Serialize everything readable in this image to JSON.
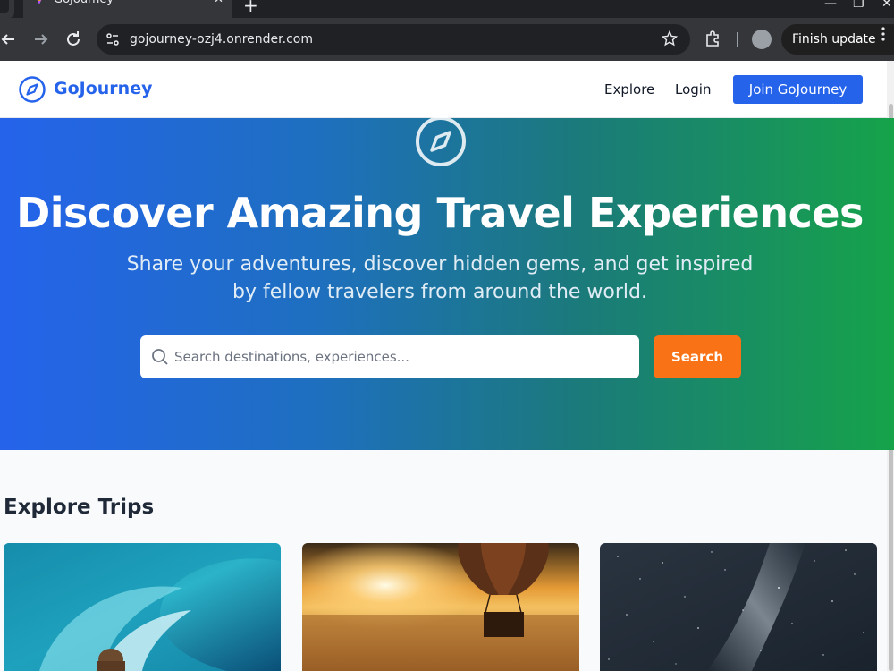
{
  "browser": {
    "tab_title": "GoJourney",
    "url": "gojourney-ozj4.onrender.com",
    "finish_update_label": "Finish update"
  },
  "header": {
    "brand": "GoJourney",
    "nav": {
      "explore": "Explore",
      "login": "Login",
      "join": "Join GoJourney"
    }
  },
  "hero": {
    "title": "Discover Amazing Travel Experiences",
    "subtitle": "Share your adventures, discover hidden gems, and get inspired by fellow travelers from around the world.",
    "search": {
      "placeholder": "Search destinations, experiences...",
      "button": "Search"
    }
  },
  "explore": {
    "title": "Explore Trips",
    "cards": [
      {
        "image": "surfer-wave-photo"
      },
      {
        "image": "hot-air-balloon-sunset-photo"
      },
      {
        "image": "milky-way-night-sky-photo"
      }
    ]
  },
  "colors": {
    "brand_blue": "#2563eb",
    "accent_orange": "#f97316",
    "hero_gradient_start": "#2563eb",
    "hero_gradient_end": "#16a34a"
  }
}
